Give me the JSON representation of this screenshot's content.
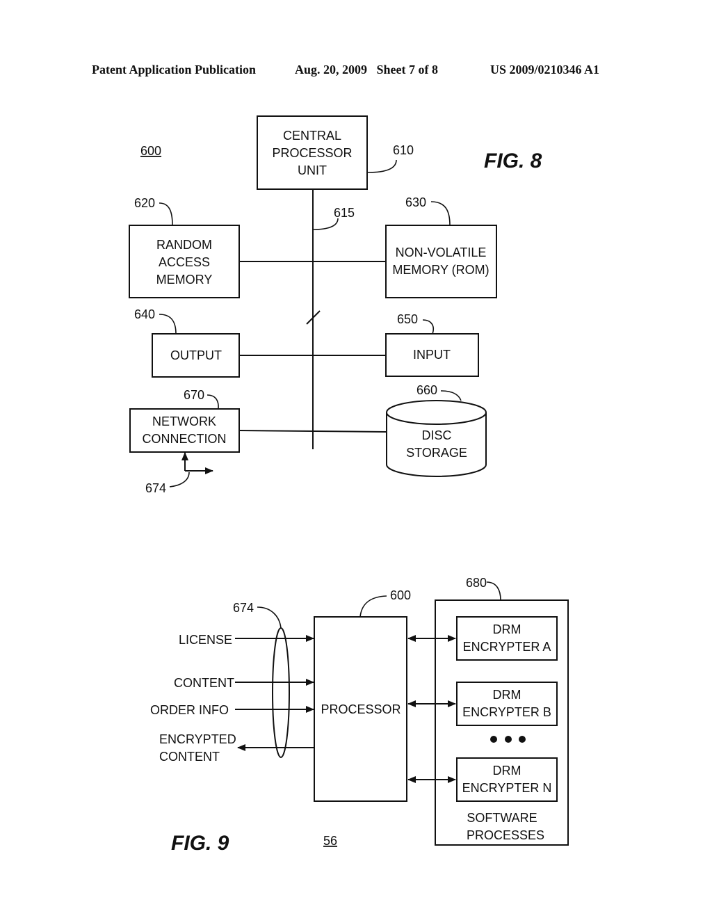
{
  "header": {
    "publication": "Patent Application Publication",
    "date_sheet": "Aug. 20, 2009   Sheet 7 of 8",
    "patent_number": "US 2009/0210346 A1"
  },
  "fig8": {
    "title": "FIG. 8",
    "system_ref": "600",
    "cpu": {
      "ref": "610",
      "lines": [
        "CENTRAL",
        "PROCESSOR",
        "UNIT"
      ]
    },
    "bus_ref": "615",
    "ram": {
      "ref": "620",
      "lines": [
        "RANDOM",
        "ACCESS",
        "MEMORY"
      ]
    },
    "rom": {
      "ref": "630",
      "lines": [
        "NON-VOLATILE",
        "MEMORY (ROM)"
      ]
    },
    "output": {
      "ref": "640",
      "lines": [
        "OUTPUT"
      ]
    },
    "input": {
      "ref": "650",
      "lines": [
        "INPUT"
      ]
    },
    "disc": {
      "ref": "660",
      "lines": [
        "DISC",
        "STORAGE"
      ]
    },
    "network": {
      "ref": "670",
      "lines": [
        "NETWORK",
        "CONNECTION"
      ]
    },
    "network_link_ref": "674"
  },
  "fig9": {
    "title": "FIG. 9",
    "page_ref": "56",
    "processor": {
      "ref": "600",
      "label": "PROCESSOR"
    },
    "link_ref": "674",
    "inputs": [
      "LICENSE",
      "CONTENT",
      "ORDER INFO"
    ],
    "output_lines": [
      "ENCRYPTED",
      "CONTENT"
    ],
    "software": {
      "ref": "680",
      "lines": [
        "SOFTWARE",
        "PROCESSES"
      ],
      "encrypters": [
        {
          "lines": [
            "DRM",
            "ENCRYPTER A"
          ]
        },
        {
          "lines": [
            "DRM",
            "ENCRYPTER B"
          ]
        },
        {
          "lines": [
            "DRM",
            "ENCRYPTER N"
          ]
        }
      ],
      "ellipsis": "• • •"
    }
  }
}
